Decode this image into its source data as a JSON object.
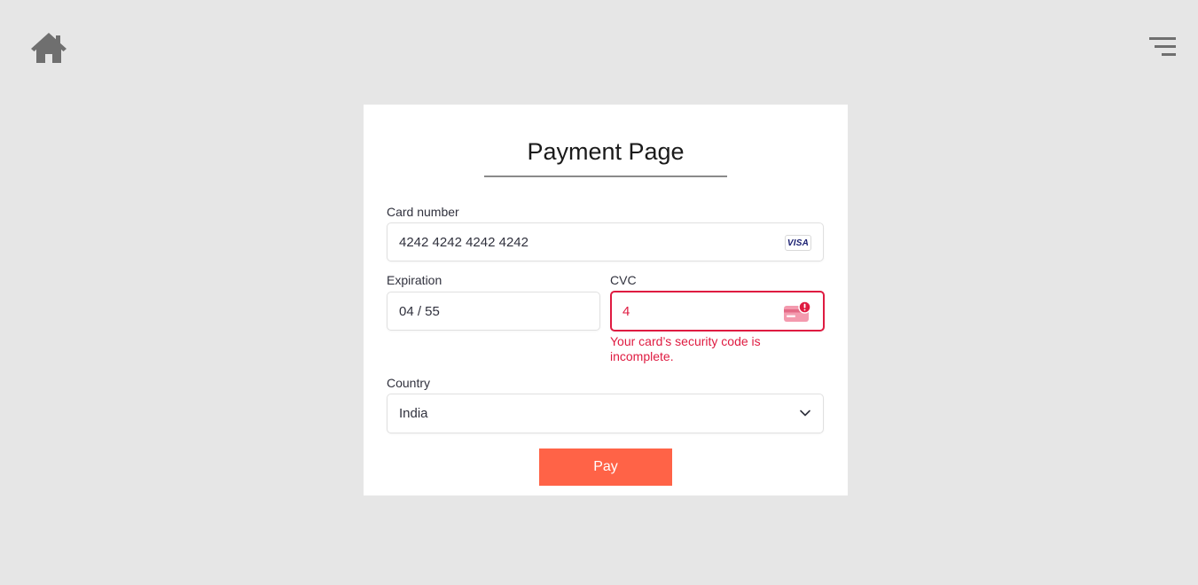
{
  "nav": {
    "home_icon": "home-icon",
    "menu_icon": "menu-lines-icon"
  },
  "form": {
    "title": "Payment Page",
    "card_number": {
      "label": "Card number",
      "value": "4242 4242 4242 4242",
      "brand": "VISA"
    },
    "expiration": {
      "label": "Expiration",
      "value": "04 / 55"
    },
    "cvc": {
      "label": "CVC",
      "value": "4",
      "error": "Your card’s security code is incomplete."
    },
    "country": {
      "label": "Country",
      "value": "India"
    },
    "pay_label": "Pay"
  },
  "colors": {
    "background": "#e6e6e6",
    "pay_button": "#ff6347",
    "error": "#df1b41"
  }
}
